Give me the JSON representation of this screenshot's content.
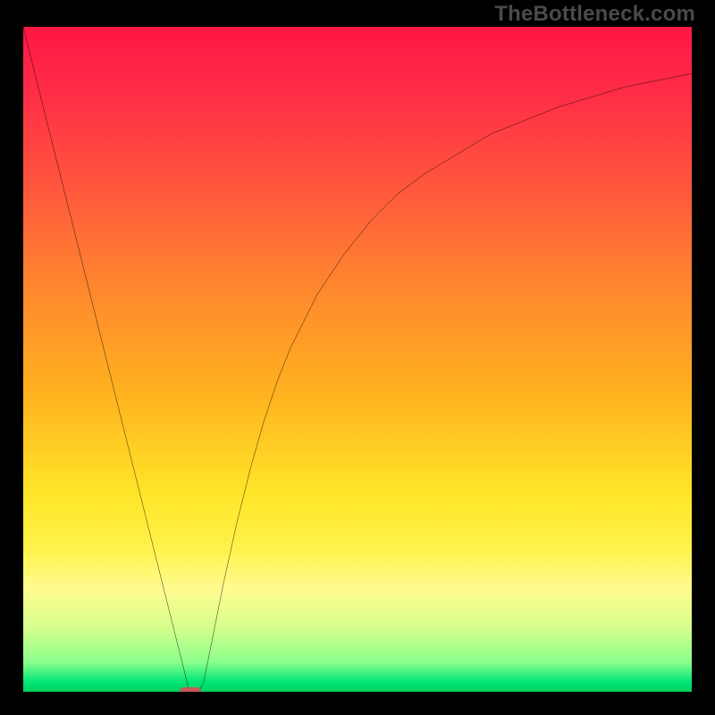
{
  "watermark": {
    "text": "TheBottleneck.com"
  },
  "chart_data": {
    "type": "line",
    "title": "",
    "xlabel": "",
    "ylabel": "",
    "xlim": [
      0,
      100
    ],
    "ylim": [
      0,
      100
    ],
    "grid": false,
    "background_gradient": {
      "orientation": "vertical",
      "stops": [
        {
          "offset": 0.0,
          "color": "#ff1744"
        },
        {
          "offset": 0.1,
          "color": "#ff2d46"
        },
        {
          "offset": 0.25,
          "color": "#ff5a3c"
        },
        {
          "offset": 0.4,
          "color": "#ff8a2d"
        },
        {
          "offset": 0.55,
          "color": "#ffb21f"
        },
        {
          "offset": 0.7,
          "color": "#ffe629"
        },
        {
          "offset": 0.78,
          "color": "#fff24a"
        },
        {
          "offset": 0.84,
          "color": "#fffb8f"
        },
        {
          "offset": 0.9,
          "color": "#d4ff8c"
        },
        {
          "offset": 0.95,
          "color": "#8cff8c"
        },
        {
          "offset": 0.98,
          "color": "#00e676"
        },
        {
          "offset": 1.0,
          "color": "#00c853"
        }
      ]
    },
    "series": [
      {
        "name": "bottleneck-curve",
        "color": "#000000",
        "x": [
          0,
          2,
          4,
          6,
          8,
          10,
          12,
          14,
          16,
          18,
          20,
          22,
          24,
          25,
          26,
          27,
          28,
          30,
          32,
          34,
          36,
          38,
          40,
          44,
          48,
          52,
          56,
          60,
          65,
          70,
          75,
          80,
          85,
          90,
          95,
          100
        ],
        "y": [
          100,
          92,
          84,
          76,
          68,
          60,
          52,
          44,
          36,
          28,
          20,
          12,
          4,
          0,
          0,
          2,
          7,
          17,
          26,
          34,
          41,
          47,
          52,
          60,
          66,
          71,
          75,
          78,
          81,
          84,
          86,
          88,
          89.5,
          91,
          92,
          93
        ]
      }
    ],
    "marker": {
      "name": "optimal-point",
      "shape": "rounded-rect",
      "color": "#c85a5a",
      "x": 25,
      "y": 0,
      "width_pct": 3.2,
      "height_pct": 1.4
    }
  }
}
